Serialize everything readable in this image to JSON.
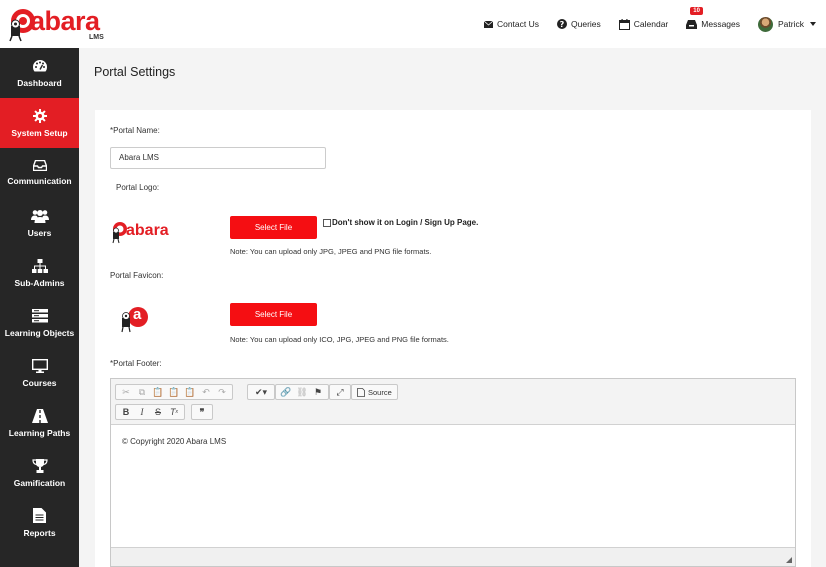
{
  "app": {
    "logo_text": "abara",
    "logo_sub": "LMS"
  },
  "topnav": {
    "contact": "Contact Us",
    "queries": "Queries",
    "calendar": "Calendar",
    "messages": "Messages",
    "messages_count": "10",
    "user": "Patrick"
  },
  "sidebar": {
    "items": [
      {
        "label": "Dashboard",
        "icon": "dashboard-icon"
      },
      {
        "label": "System Setup",
        "icon": "gear-icon"
      },
      {
        "label": "Communication",
        "icon": "inbox-icon"
      },
      {
        "label": "Users",
        "icon": "users-icon"
      },
      {
        "label": "Sub-Admins",
        "icon": "sitemap-icon"
      },
      {
        "label": "Learning Objects",
        "icon": "list-icon"
      },
      {
        "label": "Courses",
        "icon": "monitor-icon"
      },
      {
        "label": "Learning Paths",
        "icon": "road-icon"
      },
      {
        "label": "Gamification",
        "icon": "trophy-icon"
      },
      {
        "label": "Reports",
        "icon": "file-icon"
      }
    ],
    "active_index": 1
  },
  "page": {
    "title": "Portal Settings"
  },
  "form": {
    "portal_name_label": "*Portal Name:",
    "portal_name_value": "Abara LMS",
    "portal_logo_label": "Portal Logo:",
    "select_file": "Select File",
    "dont_show_label": "Don't show it on Login / Sign Up Page.",
    "logo_note": "Note: You can upload only JPG, JPEG and PNG file formats.",
    "favicon_label": "Portal Favicon:",
    "favicon_note": "Note: You can upload only ICO, JPG, JPEG and PNG file formats.",
    "footer_label": "*Portal Footer:",
    "logo_preview_text": "abara",
    "favicon_preview_text": "a"
  },
  "editor": {
    "source_label": "Source",
    "content": "© Copyright 2020 Abara LMS"
  },
  "colors": {
    "brand": "#e31e24",
    "sidebar": "#262626"
  }
}
